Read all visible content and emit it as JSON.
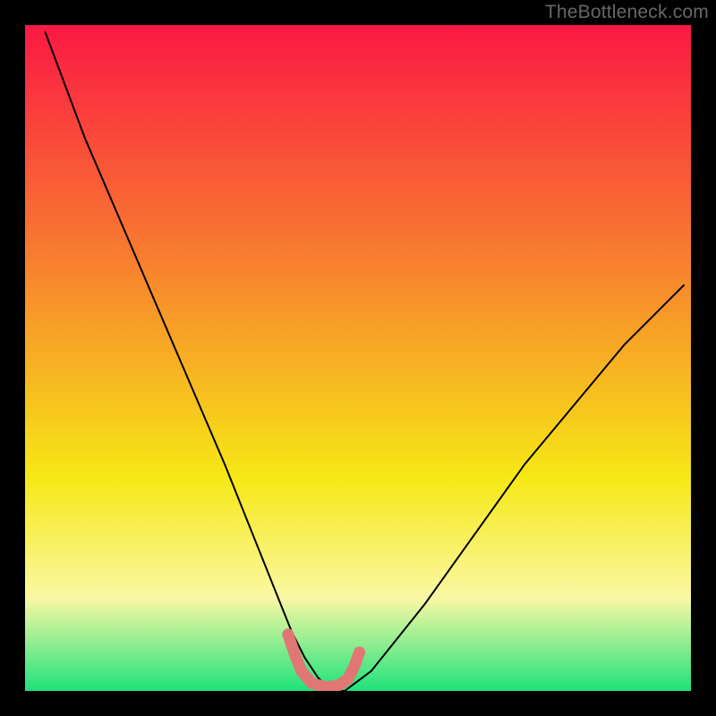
{
  "watermark": "TheBottleneck.com",
  "chart_data": {
    "type": "line",
    "title": "",
    "xlabel": "",
    "ylabel": "",
    "xlim": [
      0,
      100
    ],
    "ylim": [
      0,
      100
    ],
    "background_gradient": {
      "top": "#fb1844",
      "mid1": "#f87e2f",
      "mid2": "#f6e815",
      "mid3": "#fbf8a4",
      "bottom": "#1ee27c"
    },
    "series": [
      {
        "name": "bottleneck-curve",
        "color": "#000000",
        "stroke_width": 2,
        "x": [
          3,
          6,
          9,
          12,
          15,
          18,
          21,
          24,
          27,
          30,
          32,
          34,
          36,
          38,
          40,
          42,
          44,
          46,
          48,
          52,
          56,
          60,
          65,
          70,
          75,
          80,
          85,
          90,
          95,
          99
        ],
        "values": [
          99,
          91,
          83,
          76,
          69,
          62,
          55,
          48,
          41,
          34,
          29,
          24,
          19,
          14,
          9,
          5,
          2,
          0,
          0,
          3,
          8,
          13,
          20,
          27,
          34,
          40,
          46,
          52,
          57,
          61
        ]
      },
      {
        "name": "marker-overlay",
        "color": "#e17774",
        "stroke_width": 13,
        "linecap": "round",
        "x": [
          39.5,
          40.5,
          41.5,
          43,
          45,
          47,
          48.5,
          49.5,
          50.2
        ],
        "values": [
          8.5,
          5.5,
          3.0,
          1.2,
          0.6,
          0.8,
          1.8,
          3.8,
          5.8
        ]
      }
    ]
  }
}
